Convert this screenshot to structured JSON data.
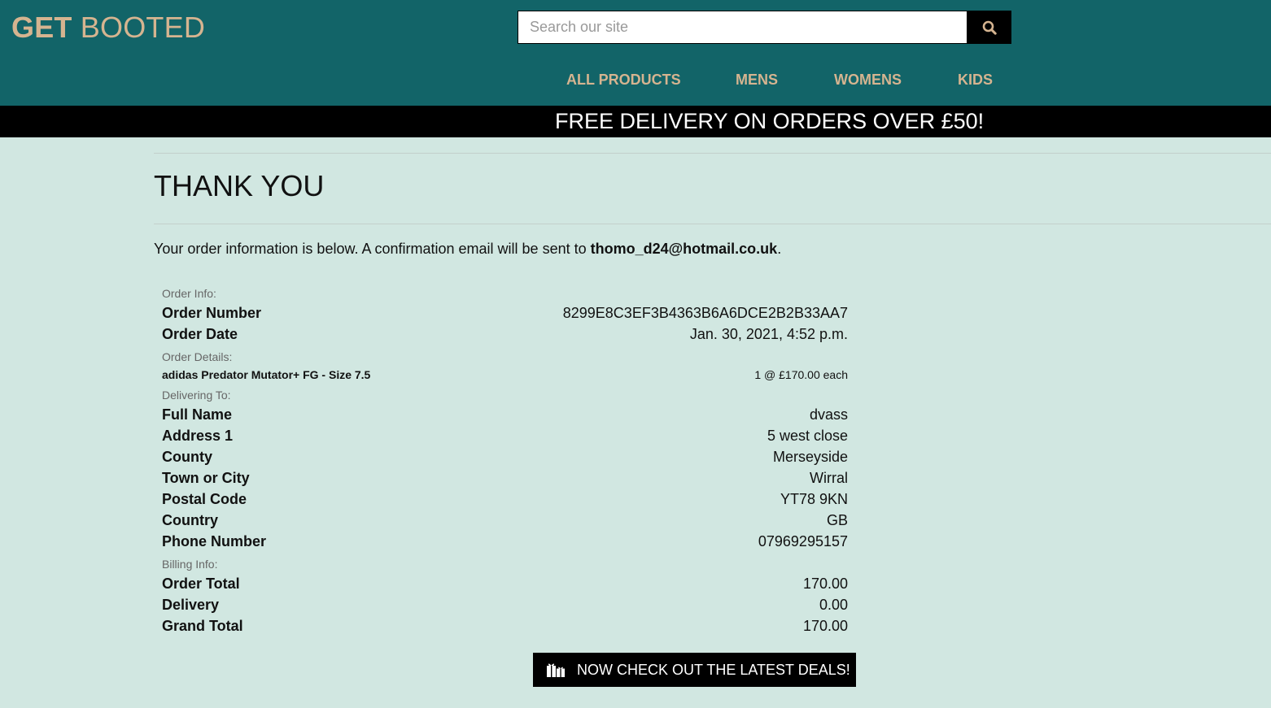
{
  "header": {
    "logo_bold": "GET",
    "logo_rest": " BOOTED",
    "search_placeholder": "Search our site",
    "search_icon": "search-icon",
    "nav": [
      "ALL PRODUCTS",
      "MENS",
      "WOMENS",
      "KIDS"
    ]
  },
  "banner": {
    "text": "FREE DELIVERY ON ORDERS OVER £50!"
  },
  "page": {
    "title": "THANK YOU",
    "intro_prefix": "Your order information is below. A confirmation email will be sent to ",
    "email": "thomo_d24@hotmail.co.uk",
    "intro_suffix": "."
  },
  "order_info": {
    "label": "Order Info:",
    "order_number_label": "Order Number",
    "order_number": "8299E8C3EF3B4363B6A6DCE2B2B33AA7",
    "order_date_label": "Order Date",
    "order_date": "Jan. 30, 2021, 4:52 p.m."
  },
  "order_details": {
    "label": "Order Details:",
    "item_name": "adidas Predator Mutator+ FG - Size 7.5",
    "item_qty_price": "1 @ £170.00 each"
  },
  "delivering_to": {
    "label": "Delivering To:",
    "fields": [
      {
        "label": "Full Name",
        "value": "dvass"
      },
      {
        "label": "Address 1",
        "value": "5 west close"
      },
      {
        "label": "County",
        "value": "Merseyside"
      },
      {
        "label": "Town or City",
        "value": "Wirral"
      },
      {
        "label": "Postal Code",
        "value": "YT78 9KN"
      },
      {
        "label": "Country",
        "value": "GB"
      },
      {
        "label": "Phone Number",
        "value": "07969295157"
      }
    ]
  },
  "billing_info": {
    "label": "Billing Info:",
    "fields": [
      {
        "label": "Order Total",
        "value": "170.00"
      },
      {
        "label": "Delivery",
        "value": "0.00"
      },
      {
        "label": "Grand Total",
        "value": "170.00"
      }
    ]
  },
  "cta": {
    "label": "NOW CHECK OUT THE LATEST DEALS!",
    "icon": "gifts-icon"
  },
  "colors": {
    "header_bg": "#126468",
    "accent_tan": "#d5b490",
    "page_bg": "#d1e7e1",
    "banner_bg": "#000000"
  }
}
